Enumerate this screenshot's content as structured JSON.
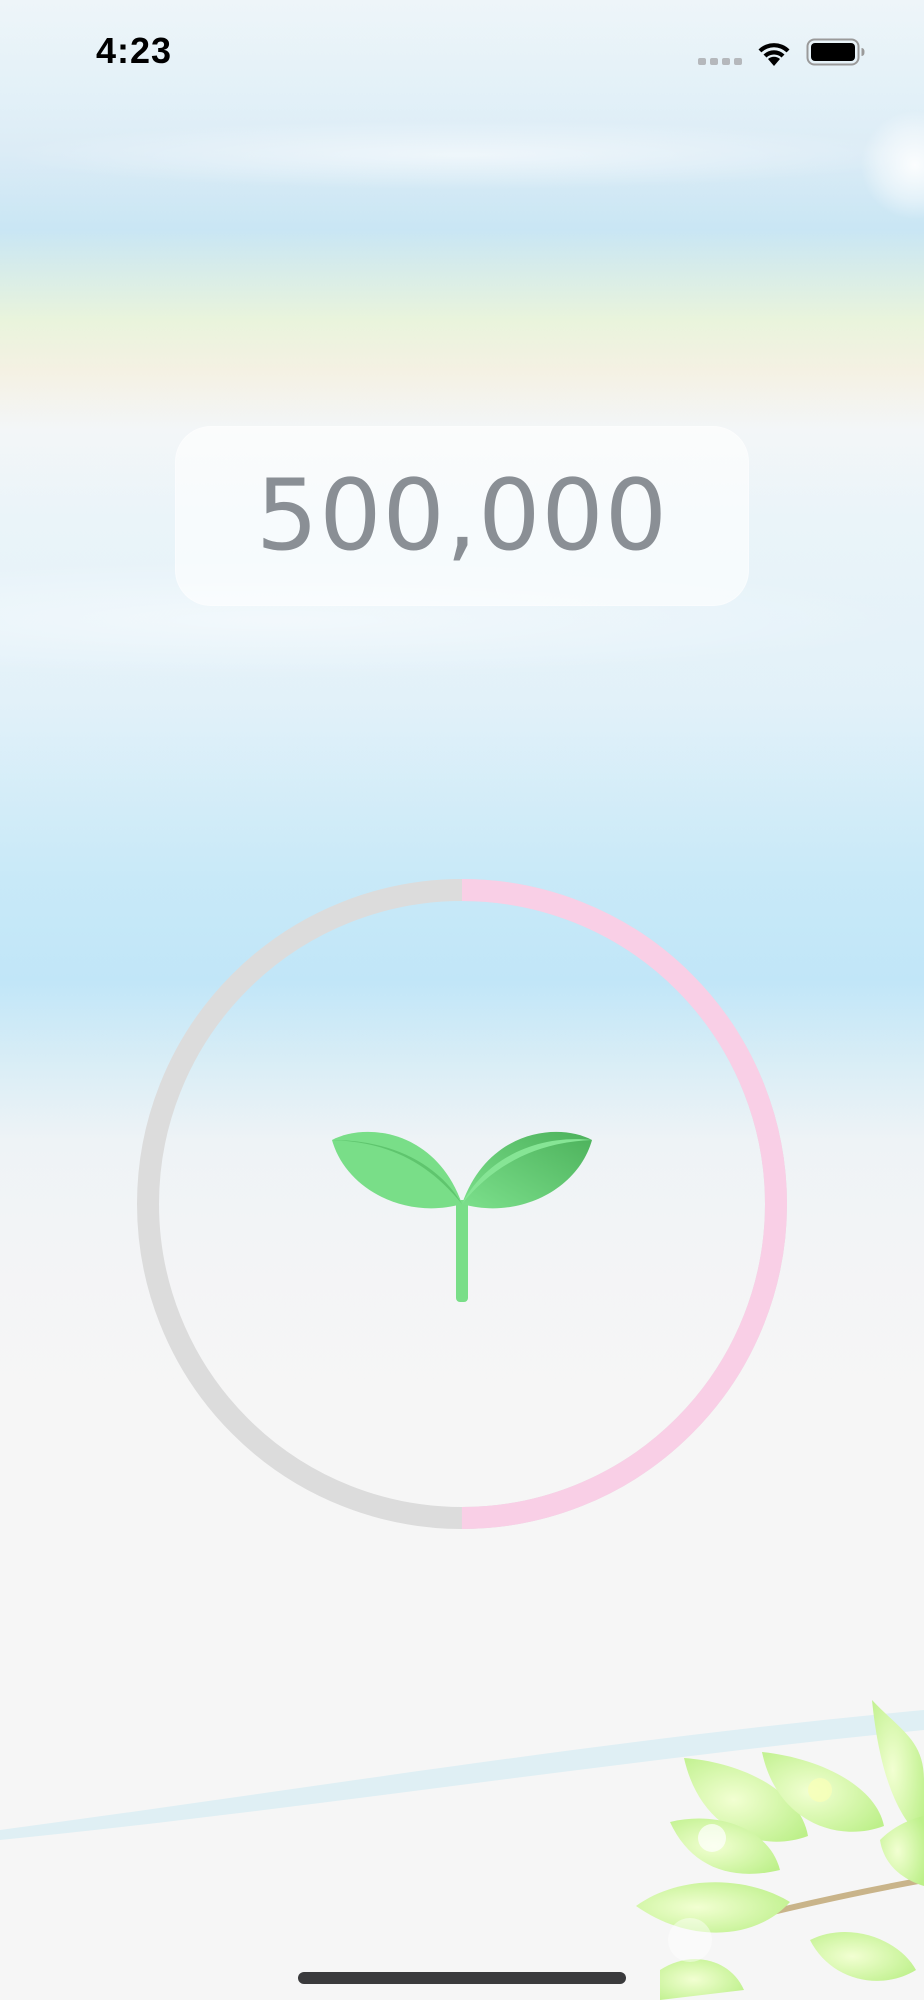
{
  "status_bar": {
    "time": "4:23",
    "icons": [
      "cellular-dots-icon",
      "wifi-icon",
      "battery-icon"
    ]
  },
  "counter": {
    "value": "500,000"
  },
  "progress": {
    "fraction": 0.5,
    "filled_color": "#f9cfe6",
    "track_color": "#dcdcdc"
  },
  "center_icon": "sprout-icon",
  "decoration": "leaves-decor",
  "colors": {
    "sprout_leaf": "#79de88",
    "sprout_leaf_dark": "#4cb15b",
    "counter_text": "#8a8f95"
  }
}
